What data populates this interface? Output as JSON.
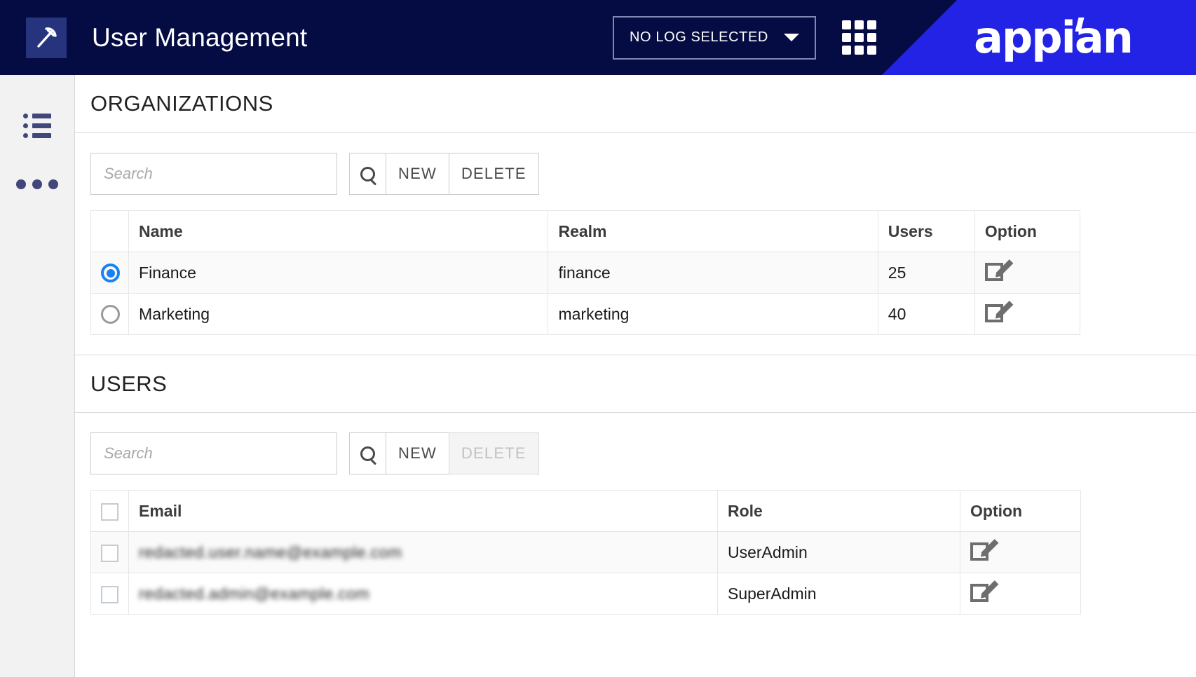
{
  "header": {
    "app_icon_name": "pickaxe-icon",
    "title": "User Management",
    "log_selector_label": "NO LOG SELECTED",
    "grid_icon_name": "app-launcher-icon",
    "brand": "appian",
    "colors": {
      "header_bg": "#050C43",
      "brand_bg": "#2323E6",
      "app_icon_bg": "#26347E"
    }
  },
  "sidebar": {
    "items": [
      {
        "name": "list-view",
        "icon": "list-icon"
      },
      {
        "name": "more-options",
        "icon": "ellipsis-icon"
      }
    ]
  },
  "organizations": {
    "title": "ORGANIZATIONS",
    "search": {
      "placeholder": "Search",
      "value": ""
    },
    "buttons": {
      "search_icon": "search-icon",
      "new_label": "NEW",
      "delete_label": "DELETE",
      "delete_disabled": false
    },
    "columns": [
      "Name",
      "Realm",
      "Users",
      "Option"
    ],
    "rows": [
      {
        "selected": true,
        "name": "Finance",
        "realm": "finance",
        "users": "25",
        "option_icon": "edit-icon"
      },
      {
        "selected": false,
        "name": "Marketing",
        "realm": "marketing",
        "users": "40",
        "option_icon": "edit-icon"
      }
    ]
  },
  "users": {
    "title": "USERS",
    "search": {
      "placeholder": "Search",
      "value": ""
    },
    "buttons": {
      "search_icon": "search-icon",
      "new_label": "NEW",
      "delete_label": "DELETE",
      "delete_disabled": true
    },
    "columns": [
      "Email",
      "Role",
      "Option"
    ],
    "rows": [
      {
        "checked": false,
        "email": "redacted.user.name@example.com",
        "email_redacted": true,
        "role": "UserAdmin",
        "option_icon": "edit-icon"
      },
      {
        "checked": false,
        "email": "redacted.admin@example.com",
        "email_redacted": true,
        "role": "SuperAdmin",
        "option_icon": "edit-icon"
      }
    ]
  },
  "accent_colors": {
    "radio_selected": "#1A82F0",
    "table_stripe": "#FAFAFA",
    "border": "#E6E6E6"
  }
}
